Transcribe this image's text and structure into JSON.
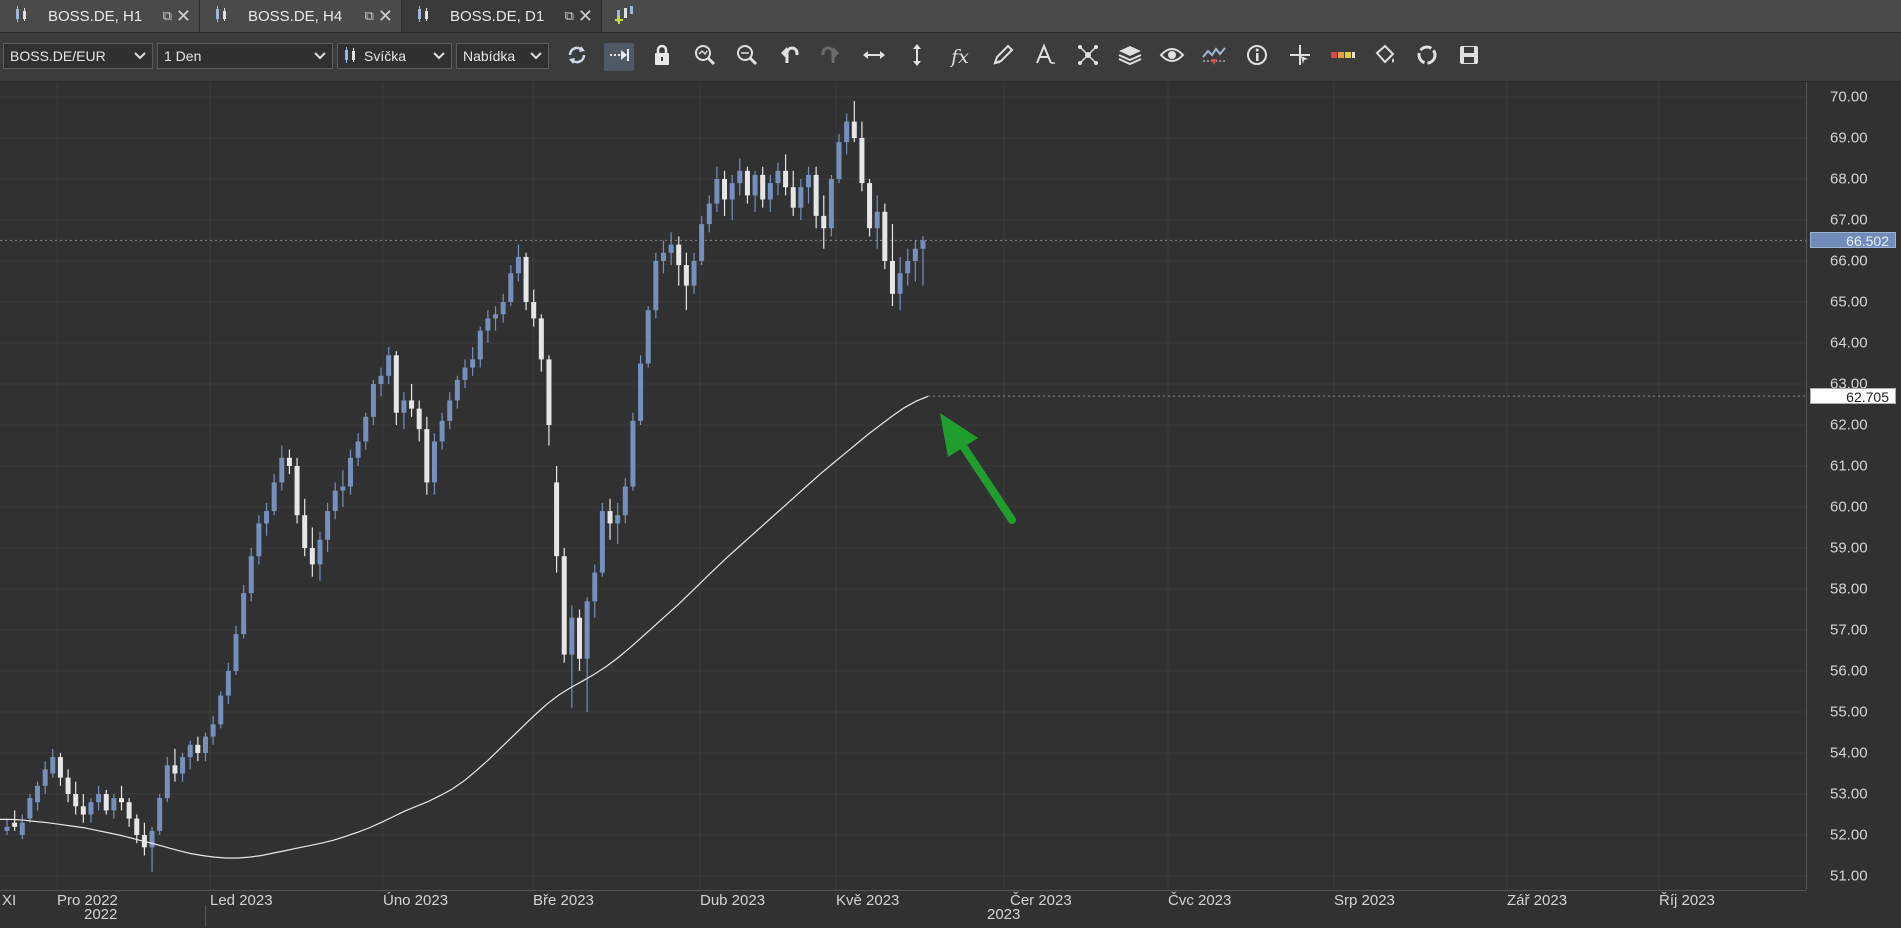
{
  "tabs": [
    {
      "label": "BOSS.DE, H1",
      "active": false
    },
    {
      "label": "BOSS.DE, H4",
      "active": false
    },
    {
      "label": "BOSS.DE, D1",
      "active": true
    }
  ],
  "toolbar": {
    "symbol": "BOSS.DE/EUR",
    "timeframe": "1 Den",
    "chart_style": "Svíčka",
    "price_type": "Nabídka",
    "buttons": [
      "refresh-icon",
      "auto-scroll-icon",
      "lock-icon",
      "zoom-in-icon",
      "zoom-out-icon",
      "undo-icon",
      "redo-icon",
      "fit-horizontal-icon",
      "fit-vertical-icon",
      "formula-icon",
      "pencil-icon",
      "text-tool-icon",
      "objects-icon",
      "layers-icon",
      "eye-icon",
      "indicator-icon",
      "info-icon",
      "crosshair-icon",
      "color-bar-icon",
      "paint-bucket-icon",
      "refresh-circle-icon",
      "save-icon"
    ]
  },
  "price_labels": {
    "last": "66.502",
    "ma": "62.705"
  },
  "chart_data": {
    "type": "candlestick",
    "symbol": "BOSS.DE/EUR",
    "timeframe": "1 Den",
    "ylim": [
      50.5,
      70.3
    ],
    "yticks": [
      "70.00",
      "69.00",
      "68.00",
      "67.00",
      "66.00",
      "65.00",
      "64.00",
      "63.00",
      "62.00",
      "61.00",
      "60.00",
      "59.00",
      "58.00",
      "57.00",
      "56.00",
      "55.00",
      "54.00",
      "53.00",
      "52.00",
      "51.00"
    ],
    "xticks": [
      "XI",
      "Pro 2022",
      "Led 2023",
      "Úno 2023",
      "Bře 2023",
      "Dub 2023",
      "Kvě 2023",
      "Čer 2023",
      "Čvc 2023",
      "Srp 2023",
      "Zář 2023",
      "Říj 2023"
    ],
    "years": [
      "2022",
      "2023"
    ],
    "candles": [
      [
        52.1,
        52.4,
        52.0,
        52.2
      ],
      [
        52.3,
        52.6,
        52.1,
        52.2
      ],
      [
        52.0,
        52.5,
        51.9,
        52.3
      ],
      [
        52.4,
        53.0,
        52.3,
        52.9
      ],
      [
        52.8,
        53.3,
        52.6,
        53.2
      ],
      [
        53.2,
        53.8,
        53.0,
        53.6
      ],
      [
        53.5,
        54.1,
        53.4,
        53.9
      ],
      [
        53.9,
        54.0,
        53.2,
        53.4
      ],
      [
        53.4,
        53.6,
        52.8,
        53.0
      ],
      [
        53.0,
        53.3,
        52.5,
        52.7
      ],
      [
        52.7,
        53.0,
        52.3,
        52.5
      ],
      [
        52.5,
        52.9,
        52.3,
        52.8
      ],
      [
        52.8,
        53.2,
        52.6,
        53.0
      ],
      [
        53.0,
        53.1,
        52.5,
        52.6
      ],
      [
        52.6,
        53.0,
        52.4,
        52.9
      ],
      [
        52.9,
        53.2,
        52.6,
        52.8
      ],
      [
        52.8,
        52.9,
        52.2,
        52.4
      ],
      [
        52.4,
        52.5,
        51.8,
        52.0
      ],
      [
        52.0,
        52.3,
        51.5,
        51.7
      ],
      [
        51.7,
        52.2,
        51.1,
        52.1
      ],
      [
        52.1,
        53.0,
        52.0,
        52.9
      ],
      [
        52.9,
        53.9,
        52.8,
        53.7
      ],
      [
        53.7,
        54.1,
        53.3,
        53.5
      ],
      [
        53.5,
        54.0,
        53.3,
        53.9
      ],
      [
        53.9,
        54.3,
        53.6,
        54.2
      ],
      [
        54.2,
        54.4,
        53.8,
        54.0
      ],
      [
        54.0,
        54.5,
        53.8,
        54.4
      ],
      [
        54.4,
        54.9,
        54.2,
        54.7
      ],
      [
        54.7,
        55.5,
        54.6,
        55.4
      ],
      [
        55.4,
        56.2,
        55.2,
        56.0
      ],
      [
        56.0,
        57.1,
        55.9,
        56.9
      ],
      [
        56.9,
        58.1,
        56.8,
        57.9
      ],
      [
        57.9,
        59.0,
        57.7,
        58.8
      ],
      [
        58.8,
        59.8,
        58.6,
        59.6
      ],
      [
        59.6,
        60.1,
        59.3,
        59.9
      ],
      [
        59.9,
        60.8,
        59.8,
        60.6
      ],
      [
        60.6,
        61.5,
        60.4,
        61.2
      ],
      [
        61.2,
        61.4,
        60.8,
        61.0
      ],
      [
        61.0,
        61.2,
        59.6,
        59.8
      ],
      [
        59.8,
        60.2,
        58.8,
        59.0
      ],
      [
        59.0,
        59.5,
        58.3,
        58.6
      ],
      [
        58.6,
        59.4,
        58.2,
        59.2
      ],
      [
        59.2,
        60.1,
        58.9,
        59.9
      ],
      [
        59.9,
        60.6,
        59.7,
        60.4
      ],
      [
        60.4,
        60.9,
        60.0,
        60.5
      ],
      [
        60.5,
        61.4,
        60.3,
        61.2
      ],
      [
        61.2,
        61.8,
        61.0,
        61.6
      ],
      [
        61.6,
        62.3,
        61.4,
        62.2
      ],
      [
        62.2,
        63.1,
        62.0,
        63.0
      ],
      [
        63.0,
        63.4,
        62.7,
        63.2
      ],
      [
        63.2,
        63.9,
        63.0,
        63.7
      ],
      [
        63.7,
        63.8,
        62.0,
        62.3
      ],
      [
        62.3,
        62.8,
        61.9,
        62.6
      ],
      [
        62.6,
        63.0,
        62.2,
        62.4
      ],
      [
        62.4,
        62.6,
        61.6,
        61.9
      ],
      [
        61.9,
        62.2,
        60.3,
        60.6
      ],
      [
        60.6,
        61.8,
        60.3,
        61.6
      ],
      [
        61.6,
        62.3,
        61.4,
        62.1
      ],
      [
        62.1,
        62.8,
        61.9,
        62.6
      ],
      [
        62.6,
        63.2,
        62.4,
        63.1
      ],
      [
        63.1,
        63.6,
        62.9,
        63.4
      ],
      [
        63.4,
        63.9,
        63.2,
        63.6
      ],
      [
        63.6,
        64.4,
        63.4,
        64.3
      ],
      [
        64.3,
        64.8,
        64.0,
        64.6
      ],
      [
        64.6,
        64.9,
        64.3,
        64.7
      ],
      [
        64.7,
        65.2,
        64.5,
        65.0
      ],
      [
        65.0,
        65.9,
        64.9,
        65.7
      ],
      [
        65.7,
        66.4,
        65.5,
        66.1
      ],
      [
        66.1,
        66.2,
        64.8,
        65.0
      ],
      [
        65.0,
        65.3,
        64.4,
        64.6
      ],
      [
        64.6,
        64.7,
        63.3,
        63.6
      ],
      [
        63.6,
        63.7,
        61.5,
        62.0
      ],
      [
        60.6,
        61.0,
        58.4,
        58.8
      ],
      [
        58.8,
        59.0,
        56.2,
        56.4
      ],
      [
        56.4,
        57.6,
        55.1,
        57.3
      ],
      [
        57.3,
        57.5,
        56.0,
        56.3
      ],
      [
        56.3,
        57.8,
        55.0,
        57.7
      ],
      [
        57.7,
        58.6,
        57.3,
        58.4
      ],
      [
        58.4,
        60.1,
        58.3,
        59.9
      ],
      [
        59.9,
        60.2,
        59.2,
        59.6
      ],
      [
        59.6,
        60.1,
        59.1,
        59.8
      ],
      [
        59.8,
        60.7,
        59.6,
        60.5
      ],
      [
        60.5,
        62.3,
        60.4,
        62.1
      ],
      [
        62.1,
        63.7,
        62.0,
        63.5
      ],
      [
        63.5,
        64.9,
        63.4,
        64.8
      ],
      [
        64.8,
        66.2,
        64.6,
        66.0
      ],
      [
        66.0,
        66.5,
        65.7,
        66.2
      ],
      [
        66.2,
        66.7,
        65.9,
        66.4
      ],
      [
        66.4,
        66.6,
        65.4,
        65.9
      ],
      [
        65.9,
        66.2,
        64.8,
        65.4
      ],
      [
        65.4,
        66.2,
        65.2,
        66.0
      ],
      [
        66.0,
        67.1,
        65.9,
        66.9
      ],
      [
        66.9,
        67.6,
        66.7,
        67.4
      ],
      [
        67.4,
        68.3,
        67.2,
        68.0
      ],
      [
        68.0,
        68.2,
        67.1,
        67.5
      ],
      [
        67.5,
        68.1,
        67.0,
        67.9
      ],
      [
        67.9,
        68.5,
        67.6,
        68.2
      ],
      [
        68.2,
        68.3,
        67.4,
        67.6
      ],
      [
        67.6,
        68.2,
        67.2,
        68.1
      ],
      [
        68.1,
        68.3,
        67.3,
        67.5
      ],
      [
        67.5,
        68.1,
        67.2,
        67.9
      ],
      [
        67.9,
        68.4,
        67.6,
        68.2
      ],
      [
        68.2,
        68.6,
        67.6,
        67.8
      ],
      [
        67.8,
        68.2,
        67.1,
        67.3
      ],
      [
        67.3,
        68.0,
        67.0,
        67.8
      ],
      [
        67.8,
        68.3,
        67.4,
        68.1
      ],
      [
        68.1,
        68.3,
        66.8,
        67.1
      ],
      [
        67.1,
        67.6,
        66.3,
        66.8
      ],
      [
        66.8,
        68.1,
        66.6,
        68.0
      ],
      [
        68.0,
        69.1,
        67.9,
        68.9
      ],
      [
        68.9,
        69.6,
        68.6,
        69.4
      ],
      [
        69.4,
        69.9,
        68.9,
        69.0
      ],
      [
        69.0,
        69.4,
        67.7,
        67.9
      ],
      [
        67.9,
        68.0,
        66.6,
        66.8
      ],
      [
        66.8,
        67.6,
        66.3,
        67.2
      ],
      [
        67.2,
        67.4,
        65.8,
        66.0
      ],
      [
        66.0,
        66.9,
        64.9,
        65.2
      ],
      [
        65.2,
        66.1,
        64.8,
        65.7
      ],
      [
        65.7,
        66.3,
        65.4,
        66.0
      ],
      [
        66.0,
        66.5,
        65.5,
        66.3
      ],
      [
        66.3,
        66.6,
        65.4,
        66.5
      ]
    ],
    "moving_average": {
      "label": "62.705",
      "points": [
        52.38,
        52.38,
        52.36,
        52.33,
        52.3,
        52.26,
        52.22,
        52.18,
        52.12,
        52.06,
        52.0,
        51.93,
        51.85,
        51.78,
        51.7,
        51.62,
        51.55,
        51.5,
        51.46,
        51.44,
        51.44,
        51.46,
        51.5,
        51.56,
        51.62,
        51.68,
        51.74,
        51.8,
        51.87,
        51.96,
        52.06,
        52.17,
        52.3,
        52.44,
        52.58,
        52.7,
        52.82,
        52.96,
        53.12,
        53.32,
        53.56,
        53.82,
        54.1,
        54.38,
        54.66,
        54.94,
        55.2,
        55.42,
        55.6,
        55.76,
        55.93,
        56.12,
        56.34,
        56.58,
        56.84,
        57.1,
        57.36,
        57.62,
        57.9,
        58.18,
        58.46,
        58.74,
        59.0,
        59.26,
        59.52,
        59.78,
        60.04,
        60.3,
        60.56,
        60.82,
        61.06,
        61.3,
        61.54,
        61.78,
        62.0,
        62.22,
        62.42,
        62.58,
        62.7
      ]
    },
    "last_price": 66.502,
    "ma_price": 62.705,
    "annotation": "green-arrow"
  }
}
